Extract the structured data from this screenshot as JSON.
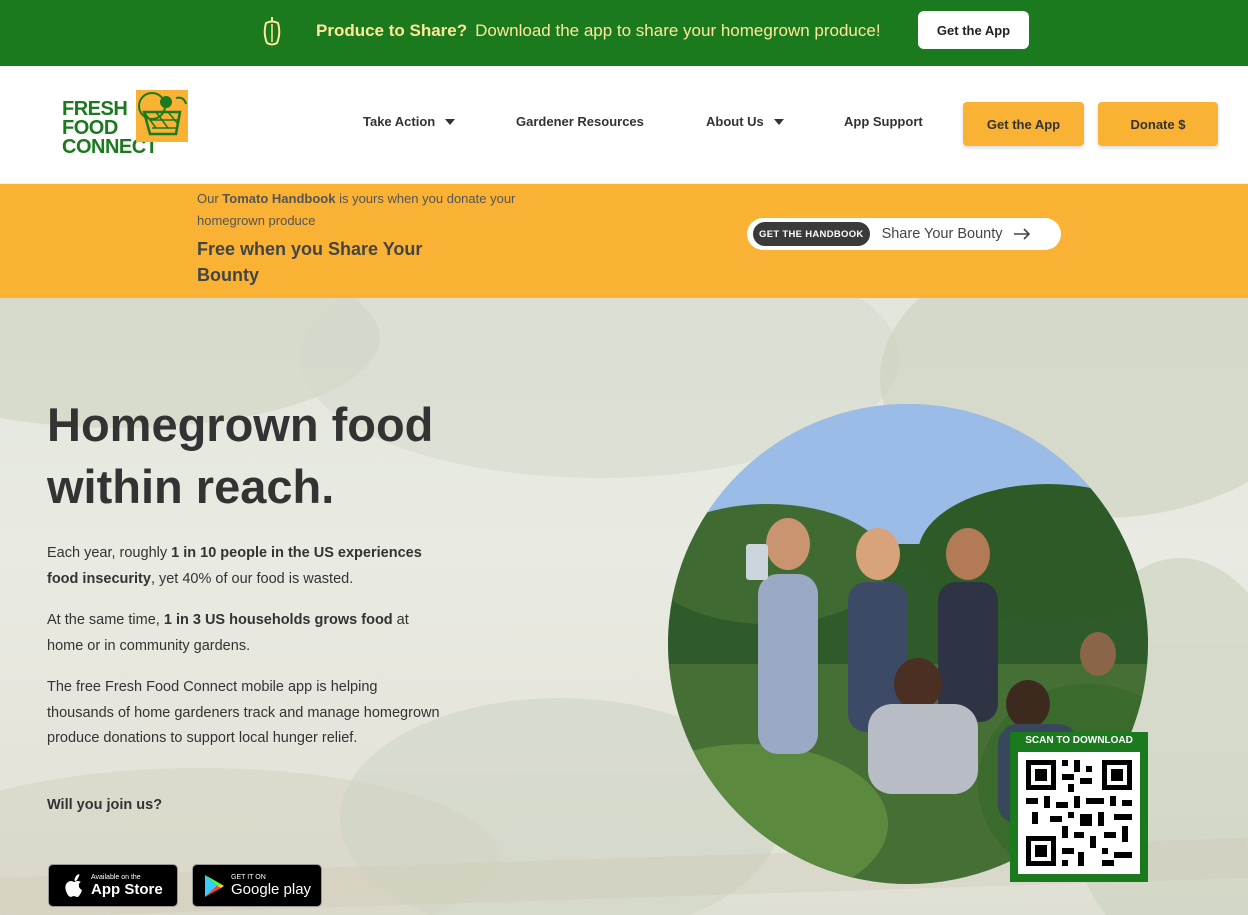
{
  "promo": {
    "title": "Produce to Share?",
    "text": "Download the app to share your homegrown produce!",
    "button": "Get the App",
    "icon": "pepper-icon"
  },
  "header": {
    "logo_lines": [
      "FRESH",
      "FOOD",
      "CONNECT"
    ],
    "nav": {
      "take_action": "Take Action",
      "gardener_resources": "Gardener Resources",
      "about_us": "About Us",
      "app_support": "App Support"
    },
    "get_app": "Get the App",
    "donate": "Donate $"
  },
  "banner": {
    "prefix": "Our",
    "handbook": "Tomato Handbook",
    "suffix": "is yours when you donate your homegrown produce",
    "headline": "Free when you Share Your Bounty",
    "tag": "GET THE HANDBOOK",
    "cta": "Share Your Bounty"
  },
  "hero": {
    "heading": "Homegrown food within reach.",
    "p1_a": "Each year, roughly ",
    "p1_b": "1 in 10 people in the US experiences food insecurity",
    "p1_c": ", yet 40% of our food is wasted.",
    "p2_a": "At the same time, ",
    "p2_b": "1 in 3 US households grows food",
    "p2_c": " at home or in community gardens.",
    "p3": "The free Fresh Food Connect mobile app is helping thousands of home gardeners track and manage homegrown produce donations to support local hunger relief.",
    "p4": "Will you join us?",
    "app_store_small": "Available on the",
    "app_store_big": "App Store",
    "google_small": "GET IT ON",
    "google_big": "Google play",
    "qr_label": "SCAN TO DOWNLOAD"
  },
  "colors": {
    "green": "#1b7a1d",
    "orange": "#f9b233",
    "cream": "#ffe89a"
  }
}
